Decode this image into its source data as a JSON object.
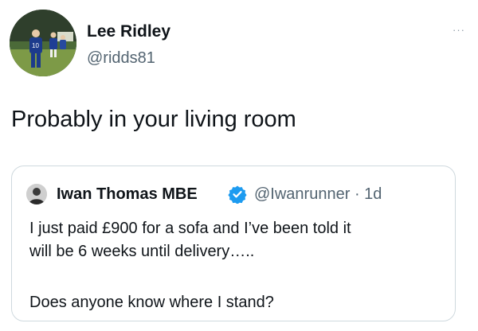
{
  "author": {
    "name": "Lee Ridley",
    "handle": "@ridds81",
    "avatar_icon": "footballer-photo-avatar",
    "more_icon": "more-options-icon",
    "more_label": "···"
  },
  "tweet": {
    "text": "Probably in your living room"
  },
  "quoted": {
    "name": "Iwan Thomas MBE",
    "verified": true,
    "verified_color": "#1d9bf0",
    "handle": "@Iwanrunner",
    "separator": "·",
    "time": "1d",
    "text_line1": "I just paid £900 for a sofa and I’ve been told it",
    "text_line2": "will be 6 weeks until delivery…..",
    "text_line3": "Does anyone know where I stand?"
  },
  "colors": {
    "text": "#0f1419",
    "secondary": "#536471",
    "border": "#cfd9de",
    "verified": "#1d9bf0"
  }
}
